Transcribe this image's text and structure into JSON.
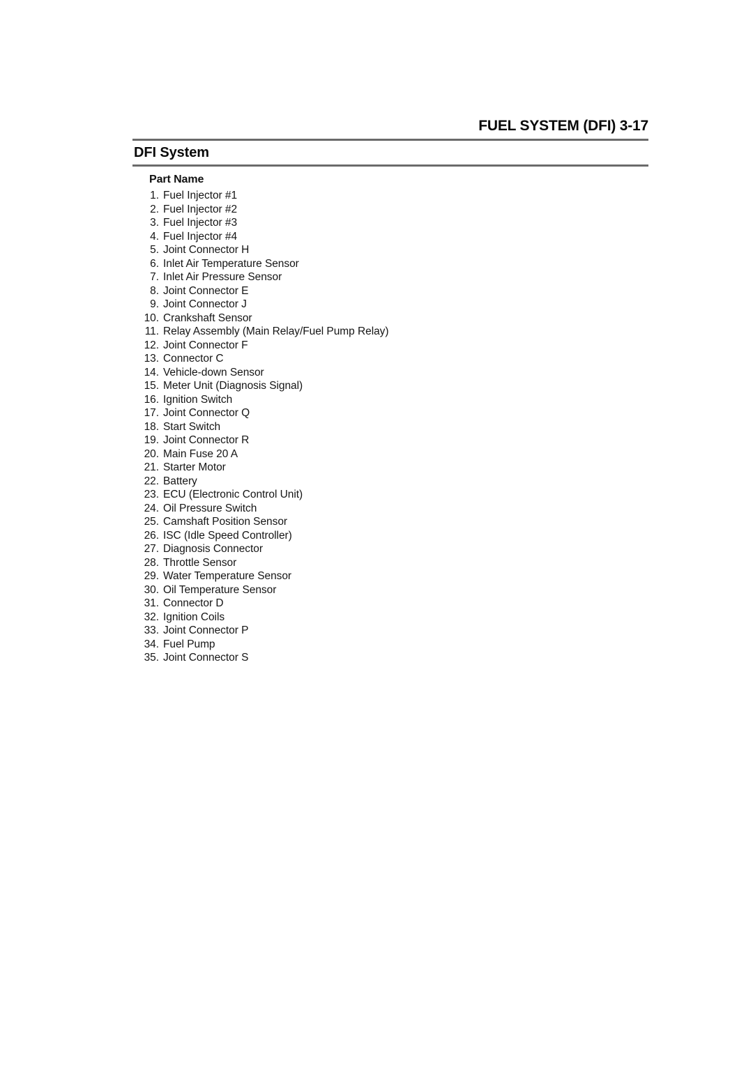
{
  "page": {
    "running_head": "FUEL SYSTEM (DFI) 3-17",
    "section_title": "DFI System",
    "list_heading": "Part Name",
    "rule_color": "#6b6b6b",
    "text_color": "#000000",
    "background_color": "#ffffff"
  },
  "parts": [
    {
      "num": "1.",
      "label": "Fuel Injector #1"
    },
    {
      "num": "2.",
      "label": "Fuel Injector #2"
    },
    {
      "num": "3.",
      "label": "Fuel Injector #3"
    },
    {
      "num": "4.",
      "label": "Fuel Injector #4"
    },
    {
      "num": "5.",
      "label": "Joint Connector H"
    },
    {
      "num": "6.",
      "label": "Inlet Air Temperature Sensor"
    },
    {
      "num": "7.",
      "label": "Inlet Air Pressure Sensor"
    },
    {
      "num": "8.",
      "label": "Joint Connector E"
    },
    {
      "num": "9.",
      "label": "Joint Connector J"
    },
    {
      "num": "10.",
      "label": "Crankshaft Sensor"
    },
    {
      "num": "11.",
      "label": "Relay Assembly (Main Relay/Fuel Pump Relay)"
    },
    {
      "num": "12.",
      "label": "Joint Connector F"
    },
    {
      "num": "13.",
      "label": "Connector C"
    },
    {
      "num": "14.",
      "label": "Vehicle-down Sensor"
    },
    {
      "num": "15.",
      "label": "Meter Unit (Diagnosis Signal)"
    },
    {
      "num": "16.",
      "label": "Ignition Switch"
    },
    {
      "num": "17.",
      "label": "Joint Connector Q"
    },
    {
      "num": "18.",
      "label": "Start Switch"
    },
    {
      "num": "19.",
      "label": "Joint Connector R"
    },
    {
      "num": "20.",
      "label": "Main Fuse 20 A"
    },
    {
      "num": "21.",
      "label": "Starter Motor"
    },
    {
      "num": "22.",
      "label": "Battery"
    },
    {
      "num": "23.",
      "label": "ECU (Electronic Control Unit)"
    },
    {
      "num": "24.",
      "label": "Oil Pressure Switch"
    },
    {
      "num": "25.",
      "label": "Camshaft Position Sensor"
    },
    {
      "num": "26.",
      "label": "ISC (Idle Speed Controller)"
    },
    {
      "num": "27.",
      "label": "Diagnosis Connector"
    },
    {
      "num": "28.",
      "label": "Throttle Sensor"
    },
    {
      "num": "29.",
      "label": "Water Temperature Sensor"
    },
    {
      "num": "30.",
      "label": "Oil Temperature Sensor"
    },
    {
      "num": "31.",
      "label": "Connector D"
    },
    {
      "num": "32.",
      "label": "Ignition Coils"
    },
    {
      "num": "33.",
      "label": "Joint Connector P"
    },
    {
      "num": "34.",
      "label": "Fuel Pump"
    },
    {
      "num": "35.",
      "label": "Joint Connector S"
    }
  ]
}
